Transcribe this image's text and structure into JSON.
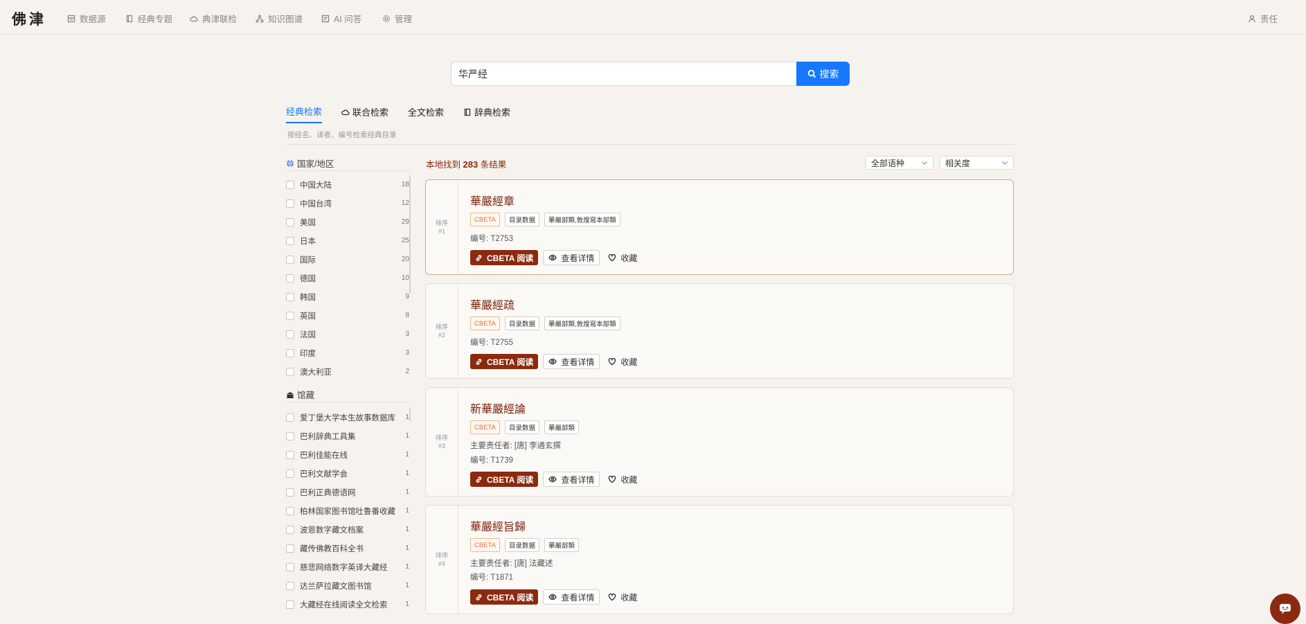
{
  "nav": {
    "logo": "佛津",
    "items": [
      {
        "label": "数据源",
        "icon": "database-icon"
      },
      {
        "label": "经典专题",
        "icon": "book-icon"
      },
      {
        "label": "典津联检",
        "icon": "cloud-icon"
      },
      {
        "label": "知识图谱",
        "icon": "graph-icon"
      },
      {
        "label": "AI 问答",
        "icon": "chat-icon"
      },
      {
        "label": "管理",
        "icon": "gear-icon"
      }
    ],
    "user": "责任"
  },
  "search": {
    "value": "华严经",
    "button_label": "搜索"
  },
  "tabs": [
    {
      "label": "经典检索",
      "active": true
    },
    {
      "label": "联合检索",
      "icon": "cloud-icon"
    },
    {
      "label": "全文检索"
    },
    {
      "label": "辞典检索",
      "icon": "book-icon"
    }
  ],
  "tab_hint": "按经名、译者、编号检索经典目录",
  "filters": {
    "region": {
      "title": "国家/地区",
      "items": [
        {
          "label": "中国大陆",
          "count": "18"
        },
        {
          "label": "中国台湾",
          "count": "12"
        },
        {
          "label": "美国",
          "count": "29"
        },
        {
          "label": "日本",
          "count": "25"
        },
        {
          "label": "国际",
          "count": "20"
        },
        {
          "label": "德国",
          "count": "10"
        },
        {
          "label": "韩国",
          "count": "9"
        },
        {
          "label": "英国",
          "count": "8"
        },
        {
          "label": "法国",
          "count": "3"
        },
        {
          "label": "印度",
          "count": "3"
        },
        {
          "label": "澳大利亚",
          "count": "2"
        }
      ]
    },
    "library": {
      "title": "馆藏",
      "items": [
        {
          "label": "爱丁堡大学本生故事数据库",
          "count": "1"
        },
        {
          "label": "巴利辞典工具集",
          "count": "1"
        },
        {
          "label": "巴利佳能在线",
          "count": "1"
        },
        {
          "label": "巴利文献学会",
          "count": "1"
        },
        {
          "label": "巴利正典德语网",
          "count": "1"
        },
        {
          "label": "柏林国家图书馆吐鲁番收藏",
          "count": "1"
        },
        {
          "label": "波恩数字藏文档案",
          "count": "1"
        },
        {
          "label": "藏传佛教百科全书",
          "count": "1"
        },
        {
          "label": "慈悲网络数字英译大藏经",
          "count": "1"
        },
        {
          "label": "达兰萨拉藏文图书馆",
          "count": "1"
        },
        {
          "label": "大藏经在线阅读全文检索",
          "count": "1"
        }
      ]
    }
  },
  "results": {
    "count_prefix": "本地找到",
    "count": "283",
    "count_suffix": "条结果",
    "lang_select": "全部语种",
    "sort_select": "相关度",
    "rank_label": "排序",
    "items": [
      {
        "rank": "#1",
        "title": "華嚴經章",
        "tags": [
          "CBETA",
          "目录数据",
          "華嚴部類,敦煌寫本部類"
        ],
        "author": "",
        "number": "编号: T2753"
      },
      {
        "rank": "#2",
        "title": "華嚴經疏",
        "tags": [
          "CBETA",
          "目录数据",
          "華嚴部類,敦煌寫本部類"
        ],
        "author": "",
        "number": "编号: T2755"
      },
      {
        "rank": "#3",
        "title": "新華嚴經論",
        "tags": [
          "CBETA",
          "目录数据",
          "華嚴部類"
        ],
        "author": "主要责任者: [唐] 李通玄撰",
        "number": "编号: T1739"
      },
      {
        "rank": "#4",
        "title": "華嚴經旨歸",
        "tags": [
          "CBETA",
          "目录数据",
          "華嚴部類"
        ],
        "author": "主要责任者: [唐] 法藏述",
        "number": "编号: T1871"
      }
    ],
    "actions": {
      "read": "CBETA 阅读",
      "detail": "查看详情",
      "favorite": "收藏"
    }
  },
  "colors": {
    "accent": "#1677ff",
    "brand": "#8b2a0f",
    "background": "#f6f3ee"
  }
}
